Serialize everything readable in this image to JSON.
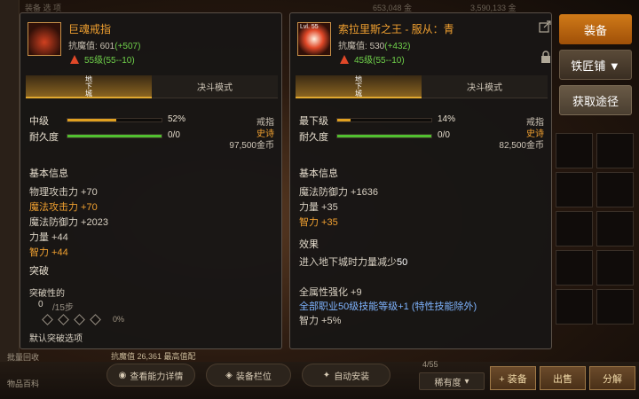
{
  "background": {
    "top_left_faint": "装备  选 项",
    "top_right_faint": "3,590,133 金",
    "mid_faint": "653,048 金",
    "under_panel_text": "抗魔值 26,361  最高值配",
    "bag_count": "4/55",
    "rarity_select": "稀有度"
  },
  "left_menu": [
    {
      "label": "批量回收"
    },
    {
      "label": "物品百科"
    }
  ],
  "bottom_buttons": [
    {
      "label": "查看能力详情"
    },
    {
      "label": "装备栏位"
    },
    {
      "label": "自动安装"
    }
  ],
  "action_buttons": [
    {
      "label": "+ 装备"
    },
    {
      "label": "出售"
    },
    {
      "label": "分解"
    }
  ],
  "side_buttons": [
    {
      "label": "装备"
    },
    {
      "label": "铁匠铺 ▼"
    },
    {
      "label": "获取途径"
    }
  ],
  "left_panel": {
    "name": "巨魂戒指",
    "resist_label": "抗魔值:",
    "resist_value": "601",
    "resist_bonus": "(+507)",
    "level": "55级(55--10)",
    "tabs": {
      "active": "地下城",
      "inactive": "决斗模式"
    },
    "grade": {
      "label": "中级",
      "percent": "52%",
      "value": 0.52
    },
    "durability": {
      "label": "耐久度",
      "value": "0/0"
    },
    "type": "戒指",
    "rarity": "史诗",
    "price": "97,500金币",
    "basic_title": "基本信息",
    "stats": [
      {
        "text": "物理攻击力 +70",
        "color": "w"
      },
      {
        "text": "魔法攻击力 +70",
        "color": "o"
      },
      {
        "text": "魔法防御力 +2023",
        "color": "w"
      },
      {
        "text": "力量 +44",
        "color": "w"
      },
      {
        "text": "智力 +44",
        "color": "o"
      }
    ],
    "break_title": "突破",
    "break_sub": "突破性的",
    "break_steps_label": "/15步",
    "break_steps_value": "0",
    "break_pct": "0%",
    "break_option": "默认突破选项"
  },
  "right_panel": {
    "name": "索拉里斯之王 - 服从：青",
    "level_badge": "Lvl. 55",
    "resist_label": "抗魔值:",
    "resist_value": "530",
    "resist_bonus": "(+432)",
    "level": "45级(55--10)",
    "tabs": {
      "active": "地下城",
      "inactive": "决斗模式"
    },
    "grade": {
      "label": "最下级",
      "percent": "14%",
      "value": 0.14
    },
    "durability": {
      "label": "耐久度",
      "value": "0/0"
    },
    "type": "戒指",
    "rarity": "史诗",
    "price": "82,500金币",
    "basic_title": "基本信息",
    "stats": [
      {
        "text": "魔法防御力 +1636",
        "color": "w"
      },
      {
        "text": "力量 +35",
        "color": "w"
      },
      {
        "text": "智力 +35",
        "color": "o"
      }
    ],
    "effect_title": "效果",
    "effect_line": "进入地下城时力量减少",
    "effect_value": "50",
    "extra": [
      {
        "text": "全属性强化 +9",
        "color": "w"
      },
      {
        "text": "全部职业50级技能等级+1 (特性技能除外)",
        "color": "b"
      },
      {
        "text": "智力 +5%",
        "color": "w"
      }
    ]
  },
  "colors": {
    "accent_orange": "#f0a030",
    "green": "#6fd04a",
    "blue": "#7fb4ff",
    "grade_bar": "#e0a020",
    "durability_bar": "#50c030"
  }
}
